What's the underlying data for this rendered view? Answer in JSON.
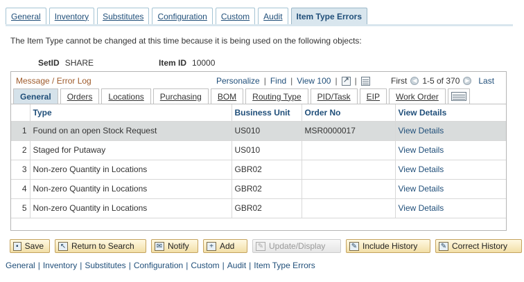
{
  "top_tabs": [
    {
      "label": "General",
      "active": false
    },
    {
      "label": "Inventory",
      "active": false
    },
    {
      "label": "Substitutes",
      "active": false
    },
    {
      "label": "Configuration",
      "active": false
    },
    {
      "label": "Custom",
      "active": false
    },
    {
      "label": "Audit",
      "active": false
    },
    {
      "label": "Item Type Errors",
      "active": true
    }
  ],
  "notice": "The Item Type cannot be changed at this time because it is being used on the following objects:",
  "fields": {
    "setid_label": "SetID",
    "setid_value": "SHARE",
    "itemid_label": "Item ID",
    "itemid_value": "10000"
  },
  "grid": {
    "title": "Message / Error Log",
    "personalize": "Personalize",
    "find": "Find",
    "view_all": "View 100",
    "first": "First",
    "range": "1-5 of 370",
    "last": "Last",
    "sep": "|",
    "tabs": [
      {
        "label": "General",
        "active": true
      },
      {
        "label": "Orders",
        "active": false
      },
      {
        "label": "Locations",
        "active": false
      },
      {
        "label": "Purchasing",
        "active": false
      },
      {
        "label": "BOM",
        "active": false
      },
      {
        "label": "Routing Type",
        "active": false
      },
      {
        "label": "PID/Task",
        "active": false
      },
      {
        "label": "EIP",
        "active": false
      },
      {
        "label": "Work Order",
        "active": false
      }
    ],
    "columns": [
      "Type",
      "Business Unit",
      "Order No",
      "View Details"
    ],
    "rows": [
      {
        "num": "1",
        "type": "Found on an open Stock Request",
        "bu": "US010",
        "order": "MSR0000017",
        "view": "View Details"
      },
      {
        "num": "2",
        "type": "Staged for Putaway",
        "bu": "US010",
        "order": "",
        "view": "View Details"
      },
      {
        "num": "3",
        "type": "Non-zero Quantity in Locations",
        "bu": "GBR02",
        "order": "",
        "view": "View Details"
      },
      {
        "num": "4",
        "type": "Non-zero Quantity in Locations",
        "bu": "GBR02",
        "order": "",
        "view": "View Details"
      },
      {
        "num": "5",
        "type": "Non-zero Quantity in Locations",
        "bu": "GBR02",
        "order": "",
        "view": "View Details"
      }
    ]
  },
  "buttons": {
    "save": "Save",
    "return_to_search": "Return to Search",
    "notify": "Notify",
    "add": "Add",
    "update_display": "Update/Display",
    "include_history": "Include History",
    "correct_history": "Correct History"
  },
  "bottom_links": [
    "General",
    "Inventory",
    "Substitutes",
    "Configuration",
    "Custom",
    "Audit",
    "Item Type Errors"
  ],
  "bottom_sep": "|",
  "colors": {
    "link": "#1f4e79",
    "grid_title": "#9e5a2a",
    "active_tab": "#d9e6ee",
    "button": "#f2dfa7"
  }
}
